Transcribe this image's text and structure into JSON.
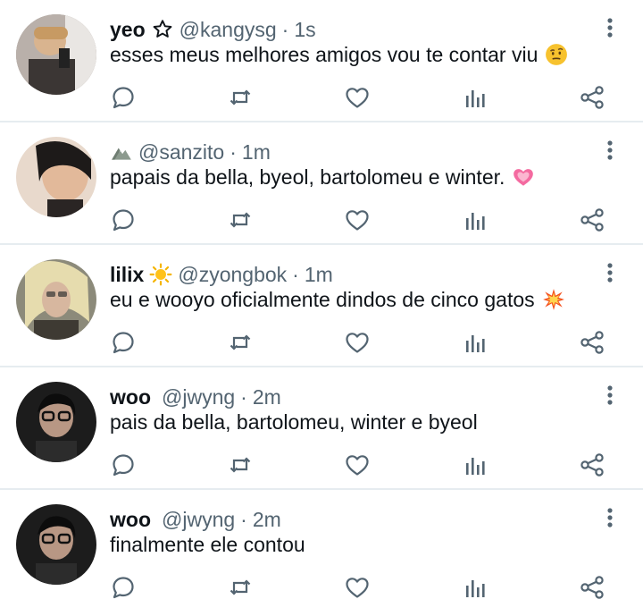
{
  "colors": {
    "text": "#0f1419",
    "secondary": "#536471",
    "divider": "#e6ecf0",
    "icon": "#536471"
  },
  "tweets": [
    {
      "name": "yeo",
      "name_decoration_icon": "star-outline-icon",
      "handle": "@kangysg",
      "sep": "·",
      "time": "1s",
      "text": "esses meus melhores amigos vou te contar viu",
      "emoji_icon": "raised-eyebrow-face-icon"
    },
    {
      "name": "",
      "name_decoration_icon": "mountain-icon",
      "handle": "@sanzito",
      "sep": "·",
      "time": "1m",
      "text": "papais da bella, byeol, bartolomeu e winter.",
      "emoji_icon": "growing-heart-icon"
    },
    {
      "name": "lilix",
      "name_decoration_icon": "sun-icon",
      "handle": "@zyongbok",
      "sep": "·",
      "time": "1m",
      "text": "eu e wooyo oficialmente dindos de cinco gatos",
      "emoji_icon": "collision-icon"
    },
    {
      "name": "woo",
      "name_decoration_icon": "",
      "handle": "@jwyng",
      "sep": "·",
      "time": "2m",
      "text": "pais da bella, bartolomeu, winter e byeol",
      "emoji_icon": ""
    },
    {
      "name": "woo",
      "name_decoration_icon": "",
      "handle": "@jwyng",
      "sep": "·",
      "time": "2m",
      "text": "finalmente ele contou",
      "emoji_icon": ""
    }
  ]
}
